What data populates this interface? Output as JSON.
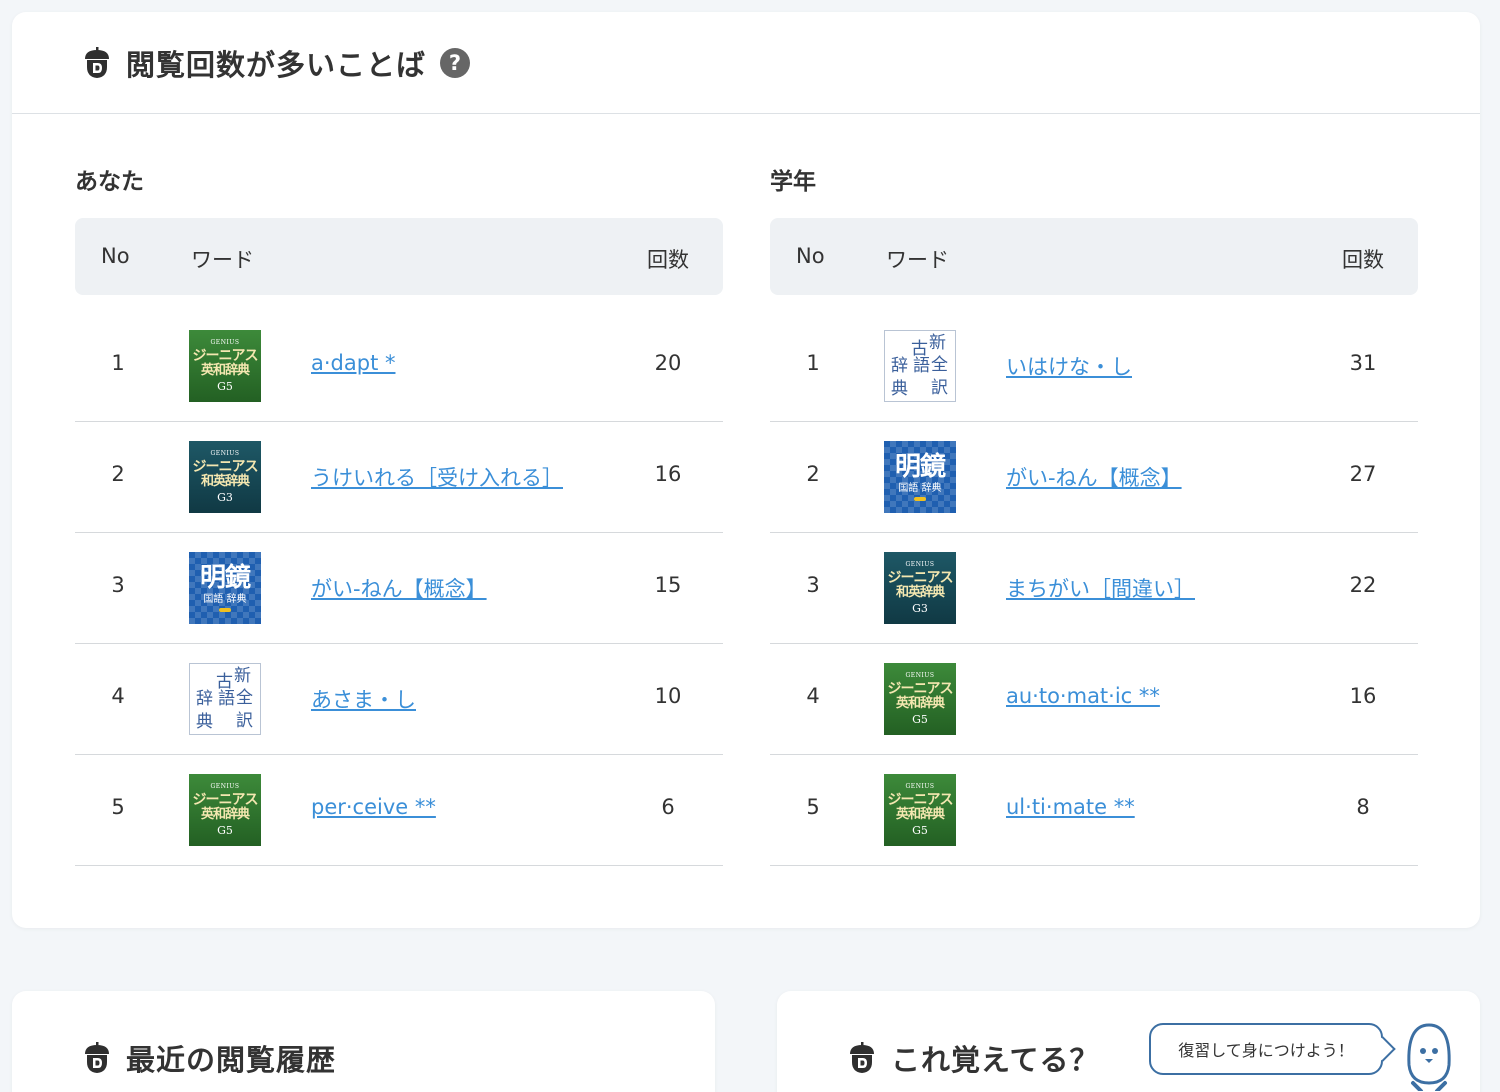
{
  "ranking": {
    "title": "閲覧回数が多いことば",
    "help": "?",
    "columns": {
      "no": "No",
      "word": "ワード",
      "count": "回数"
    },
    "you": {
      "label": "あなた",
      "rows": [
        {
          "no": "1",
          "dict": "genius-g5",
          "word": "a·dapt *",
          "count": "20"
        },
        {
          "no": "2",
          "dict": "genius-g3",
          "word": "うけいれる［受け入れる］",
          "count": "16"
        },
        {
          "no": "3",
          "dict": "meikyo",
          "word": "がい‐ねん【概念】",
          "count": "15"
        },
        {
          "no": "4",
          "dict": "kogo",
          "word": "あさま・し",
          "count": "10"
        },
        {
          "no": "5",
          "dict": "genius-g5",
          "word": "per·ceive **",
          "count": "6"
        }
      ]
    },
    "grade": {
      "label": "学年",
      "rows": [
        {
          "no": "1",
          "dict": "kogo",
          "word": "いはけな・し",
          "count": "31"
        },
        {
          "no": "2",
          "dict": "meikyo",
          "word": "がい‐ねん【概念】",
          "count": "27"
        },
        {
          "no": "3",
          "dict": "genius-g3",
          "word": "まちがい［間違い］",
          "count": "22"
        },
        {
          "no": "4",
          "dict": "genius-g5",
          "word": "au·to·mat·ic **",
          "count": "16"
        },
        {
          "no": "5",
          "dict": "genius-g5",
          "word": "ul·ti·mate **",
          "count": "8"
        }
      ]
    }
  },
  "dict_covers": {
    "genius-g5": {
      "brand": "GENIUS",
      "line1": "ジーニアス",
      "line2": "英和辞典",
      "edition": "G5"
    },
    "genius-g3": {
      "brand": "GENIUS",
      "line1": "ジーニアス",
      "line2": "和英辞典",
      "edition": "G3"
    },
    "meikyo": {
      "big": "明鏡",
      "small": "国語 辞典"
    },
    "kogo": {
      "chars": [
        "新",
        "古",
        "全",
        "語",
        "辞",
        "訳",
        "典"
      ]
    }
  },
  "recent": {
    "title": "最近の閲覧履歴"
  },
  "remember": {
    "title": "これ覚えてる？",
    "bubble": "復習して身につけよう！"
  },
  "colors": {
    "link": "#3b8fd8",
    "header_bg": "#eef1f4",
    "page_bg": "#f3f6f9",
    "accent": "#3c6fa3"
  }
}
